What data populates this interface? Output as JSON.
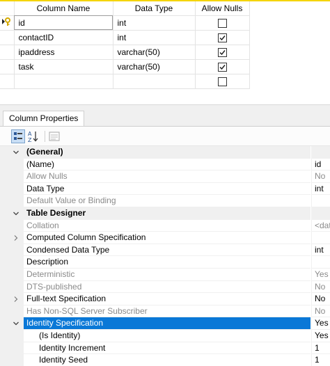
{
  "grid": {
    "headers": [
      "Column Name",
      "Data Type",
      "Allow Nulls"
    ],
    "rows": [
      {
        "name": "id",
        "type": "int",
        "allow_nulls": false,
        "primary_key": true
      },
      {
        "name": "contactID",
        "type": "int",
        "allow_nulls": true
      },
      {
        "name": "ipaddress",
        "type": "varchar(50)",
        "allow_nulls": true
      },
      {
        "name": "task",
        "type": "varchar(50)",
        "allow_nulls": true
      },
      {
        "name": "",
        "type": "",
        "allow_nulls": false
      }
    ]
  },
  "properties_panel": {
    "tab_label": "Column Properties",
    "toolbar": [
      "categorized-icon",
      "alphabetical-icon",
      "property-pages-icon"
    ],
    "rows": [
      {
        "kind": "category",
        "expanded": true,
        "name": "(General)",
        "value": ""
      },
      {
        "kind": "prop",
        "name": "(Name)",
        "value": "id"
      },
      {
        "kind": "prop",
        "dim": true,
        "name": "Allow Nulls",
        "value": "No"
      },
      {
        "kind": "prop",
        "name": "Data Type",
        "value": "int"
      },
      {
        "kind": "prop",
        "dim": true,
        "name": "Default Value or Binding",
        "value": ""
      },
      {
        "kind": "category",
        "expanded": true,
        "name": "Table Designer",
        "value": ""
      },
      {
        "kind": "prop",
        "dim": true,
        "name": "Collation",
        "value": "<dat"
      },
      {
        "kind": "prop",
        "expandable": true,
        "name": "Computed Column Specification",
        "value": ""
      },
      {
        "kind": "prop",
        "name": "Condensed Data Type",
        "value": "int"
      },
      {
        "kind": "prop",
        "name": "Description",
        "value": ""
      },
      {
        "kind": "prop",
        "dim": true,
        "name": "Deterministic",
        "value": "Yes"
      },
      {
        "kind": "prop",
        "dim": true,
        "name": "DTS-published",
        "value": "No"
      },
      {
        "kind": "prop",
        "expandable": true,
        "name": "Full-text Specification",
        "value": "No"
      },
      {
        "kind": "prop",
        "dim": true,
        "name": "Has Non-SQL Server Subscriber",
        "value": "No"
      },
      {
        "kind": "prop",
        "expanded": true,
        "selected": true,
        "name": "Identity Specification",
        "value": "Yes"
      },
      {
        "kind": "prop",
        "sub": true,
        "name": "(Is Identity)",
        "value": "Yes"
      },
      {
        "kind": "prop",
        "sub": true,
        "name": "Identity Increment",
        "value": "1"
      },
      {
        "kind": "prop",
        "sub": true,
        "name": "Identity Seed",
        "value": "1"
      }
    ]
  },
  "colors": {
    "accent_top": "#f5d400",
    "selection": "#0a78d7",
    "key_icon": "#d4a900"
  }
}
